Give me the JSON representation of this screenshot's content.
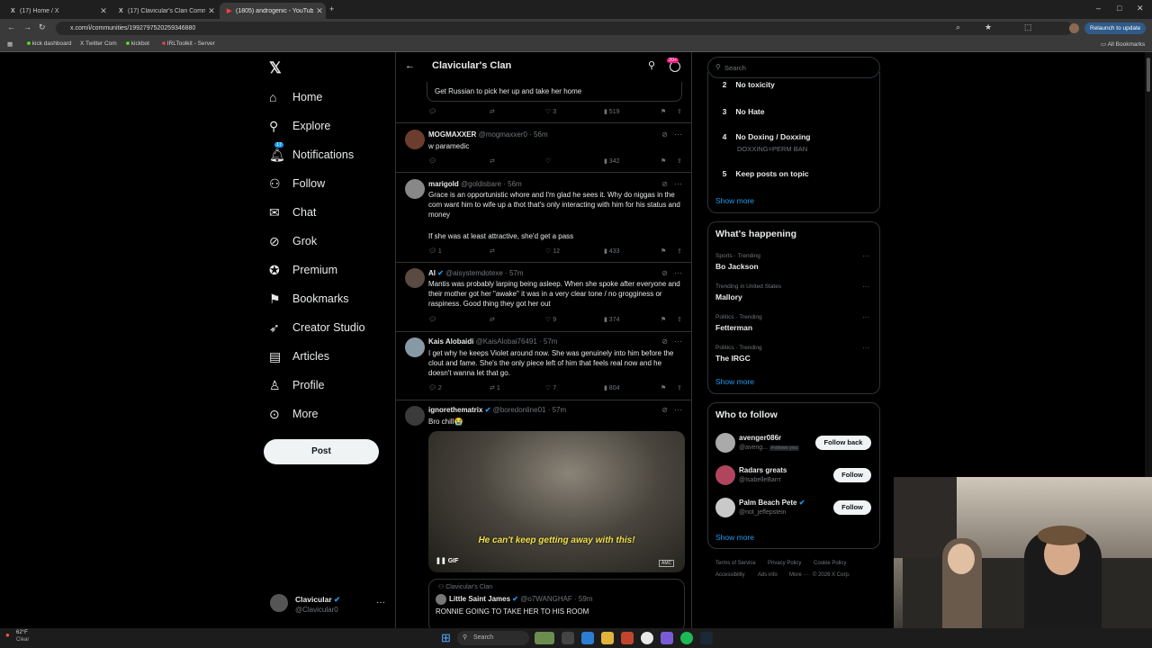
{
  "tabs": [
    {
      "label": "(17) Home / X",
      "fav": "X"
    },
    {
      "label": "(17) Clavicular's Clan Communi",
      "fav": "X"
    },
    {
      "label": "(1805) androgenic - YouTube",
      "fav": "▶"
    }
  ],
  "url": "x.com/i/communities/1992797520259346880",
  "relaunch": "Relaunch to update",
  "bookmarks": [
    "kick dashboard",
    "Twitter Com",
    "kickbot",
    "IRLToolkit - Server"
  ],
  "all_bookmarks": "All Bookmarks",
  "nav": {
    "items": [
      "Home",
      "Explore",
      "Notifications",
      "Follow",
      "Chat",
      "Grok",
      "Premium",
      "Bookmarks",
      "Creator Studio",
      "Articles",
      "Profile",
      "More"
    ],
    "notif_badge": "17",
    "post": "Post"
  },
  "account": {
    "name": "Clavicular",
    "handle": "@Clavicular0"
  },
  "header": {
    "title": "Clavicular's Clan",
    "badge": "20+"
  },
  "tweets": [
    {
      "body": "Get Russian to pick her up and take her home",
      "likes": "3",
      "views": "519"
    },
    {
      "name": "MOGMAXXER",
      "handle": "@mogmaxxer0 · 56m",
      "body": "w paramedic",
      "views": "342"
    },
    {
      "name": "marigold",
      "handle": "@goldisbare · 56m",
      "body": "Grace is an opportunistic whore and I'm glad he sees it. Why do niggas in the com want him to wife up a thot that's only interacting with him for his status and money",
      "body2": "If she was at least attractive, she'd get a pass",
      "replies": "1",
      "likes": "12",
      "views": "433"
    },
    {
      "name": "AI",
      "handle": "@aisystemdotexe · 57m",
      "body": "Mantis was probably larping being asleep. When she spoke after everyone and their mother got her \"awake\" it was in a very clear tone / no grogginess or raspiness. Good thing they got her out",
      "likes": "9",
      "views": "374"
    },
    {
      "name": "Kais Alobaidi",
      "handle": "@KaisAlobai76491 · 57m",
      "body": "I get why he keeps Violet around now. She was genuinely into him before the clout and fame. She's the only piece left of him that feels real now and he doesn't wanna let that go.",
      "replies": "2",
      "reposts": "1",
      "likes": "7",
      "views": "804"
    },
    {
      "name": "ignorethematrix",
      "handle": "@boredonline01 · 57m",
      "body": "Bro chill😭",
      "gif_caption": "He can't keep getting away with this!",
      "gif_label": "GIF",
      "gif_watermark": "AMC",
      "quote_community": "Clavicular's Clan",
      "quote_name": "Little Saint James",
      "quote_handle": "@o7WANGHAF · 59m",
      "quote_body": "RONNIE GOING TO TAKE HER TO HIS ROOM"
    }
  ],
  "search_placeholder": "Search",
  "rules": [
    {
      "n": "2",
      "t": "No toxicity"
    },
    {
      "n": "3",
      "t": "No Hate"
    },
    {
      "n": "4",
      "t": "No Doxing / Doxxing",
      "sub": "DOXXING=PERM BAN"
    },
    {
      "n": "5",
      "t": "Keep posts on topic"
    }
  ],
  "show_more": "Show more",
  "happening": {
    "title": "What's happening",
    "trends": [
      {
        "cat": "Sports · Trending",
        "name": "Bo Jackson"
      },
      {
        "cat": "Trending in United States",
        "name": "Mallory"
      },
      {
        "cat": "Politics · Trending",
        "name": "Fetterman"
      },
      {
        "cat": "Politics · Trending",
        "name": "The IRGC"
      }
    ]
  },
  "who": {
    "title": "Who to follow",
    "people": [
      {
        "name": "avenger086r",
        "handle": "@aveng...",
        "follows_you": "Follows you",
        "btn": "Follow back"
      },
      {
        "name": "Radars greats",
        "handle": "@IsabelleBarrr",
        "btn": "Follow"
      },
      {
        "name": "Palm Beach Pete",
        "handle": "@not_jeffepstein",
        "btn": "Follow"
      }
    ]
  },
  "footer": [
    "Terms of Service",
    "Privacy Policy",
    "Cookie Policy",
    "Accessibility",
    "Ads info",
    "More ···",
    "© 2026 X Corp."
  ],
  "taskbar": {
    "search": "Search",
    "weather_temp": "62°F",
    "weather_text": "Clear"
  }
}
